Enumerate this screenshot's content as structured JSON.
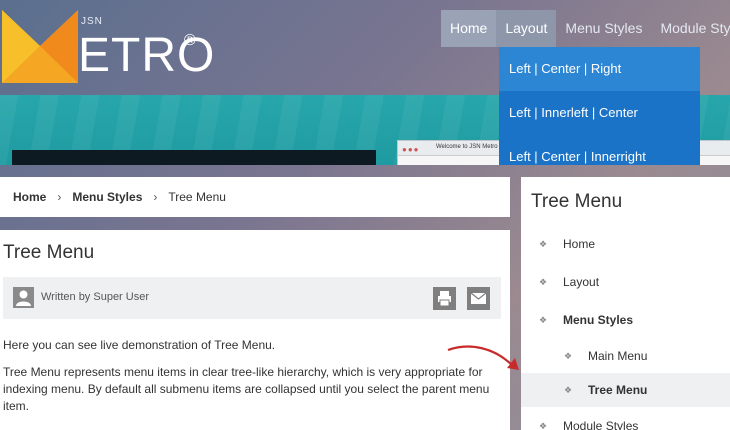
{
  "colors": {
    "nav_home_bg": "#9aa3b6",
    "dropdown_bg": "#1a73c6",
    "hero_teal": "#27a6ab",
    "arrow": "#c82b2b",
    "logo_orange": "#f5a623"
  },
  "logo": {
    "jsn": "JSN",
    "text": "ETRO",
    "reg": "®"
  },
  "nav": [
    {
      "label": "Home"
    },
    {
      "label": "Layout"
    },
    {
      "label": "Menu Styles"
    },
    {
      "label": "Module Sty"
    }
  ],
  "dropdown": [
    {
      "label": "Left | Center | Right"
    },
    {
      "label": "Left | Innerleft | Center"
    },
    {
      "label": "Left | Center | Innerright"
    }
  ],
  "hero": {
    "browser_tab": "Welcome to JSN Metro"
  },
  "breadcrumb": {
    "home": "Home",
    "sep": "›",
    "section": "Menu Styles",
    "current": "Tree Menu"
  },
  "article": {
    "title": "Tree Menu",
    "author": "Written by Super User",
    "intro": "Here you can see live demonstration of Tree Menu.",
    "description": "Tree Menu represents menu items in clear tree-like hierarchy, which is very appropriate for indexing menu. By default all submenu items are collapsed until you select the parent menu item."
  },
  "sidebar": {
    "title": "Tree Menu",
    "bullet": "❖",
    "items": [
      {
        "label": "Home"
      },
      {
        "label": "Layout"
      },
      {
        "label": "Menu Styles"
      },
      {
        "label": "Main Menu"
      },
      {
        "label": "Tree Menu"
      },
      {
        "label": "Module Styles"
      }
    ]
  },
  "icons": [
    "user-icon",
    "print-icon",
    "email-icon",
    "bullet-icon",
    "arrow-annotation"
  ]
}
